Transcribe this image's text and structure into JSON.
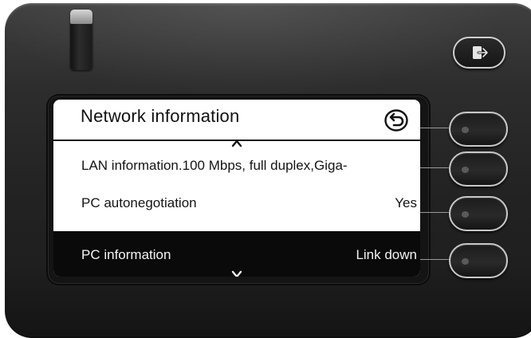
{
  "screen": {
    "title": "Network information"
  },
  "rows": [
    {
      "label": "LAN information.100 Mbps, full duplex,Giga-",
      "value": ""
    },
    {
      "label": "PC autonegotiation",
      "value": "Yes"
    },
    {
      "label": "PC information",
      "value": "Link down",
      "selected": true
    }
  ],
  "icons": {
    "back": "back-arrow-circle-icon",
    "scroll_up": "chevron-up-icon",
    "scroll_down": "chevron-down-icon",
    "logout": "logout-icon"
  },
  "colors": {
    "screen_bg": "#ffffff",
    "selection_bg": "#0a0a0a",
    "device_body": "#2a2a2a"
  }
}
